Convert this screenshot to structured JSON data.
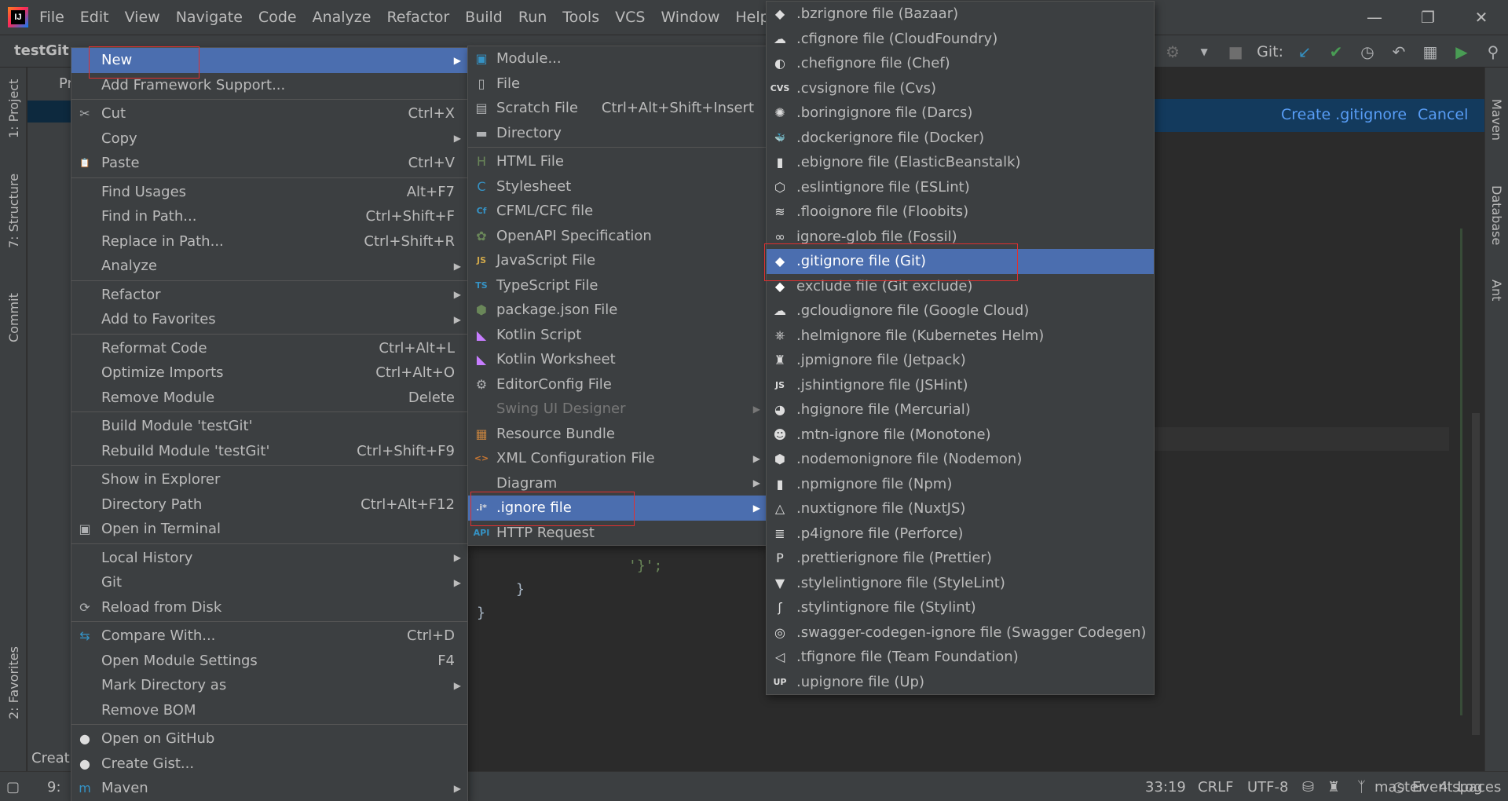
{
  "menubar": {
    "logo": "IJ",
    "items": [
      "File",
      "Edit",
      "View",
      "Navigate",
      "Code",
      "Analyze",
      "Refactor",
      "Build",
      "Run",
      "Tools",
      "VCS",
      "Window",
      "Help"
    ]
  },
  "navbar": {
    "project": "testGit",
    "git_label": "Git:"
  },
  "left_tabs": {
    "project": "1: Project",
    "structure": "7: Structure",
    "commit": "Commit",
    "favorites": "2: Favorites"
  },
  "right_tabs": {
    "maven": "Maven",
    "database": "Database",
    "ant": "Ant"
  },
  "panel": {
    "tab": "Pr"
  },
  "git_banner": {
    "create": "Create .gitignore",
    "cancel": "Cancel"
  },
  "code": {
    "line1": "'}';",
    "line2": "}",
    "line3": "}"
  },
  "context_menu": {
    "items": [
      {
        "label": "New",
        "shortcut": "",
        "submenu": true,
        "icon": ""
      },
      {
        "label": "Add Framework Support...",
        "shortcut": "",
        "submenu": false,
        "icon": ""
      },
      {
        "label": "Cut",
        "shortcut": "Ctrl+X",
        "submenu": false,
        "icon": "scissors-icon"
      },
      {
        "label": "Copy",
        "shortcut": "",
        "submenu": true,
        "icon": ""
      },
      {
        "label": "Paste",
        "shortcut": "Ctrl+V",
        "submenu": false,
        "icon": "clipboard-icon"
      },
      {
        "label": "Find Usages",
        "shortcut": "Alt+F7",
        "submenu": false,
        "icon": ""
      },
      {
        "label": "Find in Path...",
        "shortcut": "Ctrl+Shift+F",
        "submenu": false,
        "icon": ""
      },
      {
        "label": "Replace in Path...",
        "shortcut": "Ctrl+Shift+R",
        "submenu": false,
        "icon": ""
      },
      {
        "label": "Analyze",
        "shortcut": "",
        "submenu": true,
        "icon": ""
      },
      {
        "label": "Refactor",
        "shortcut": "",
        "submenu": true,
        "icon": ""
      },
      {
        "label": "Add to Favorites",
        "shortcut": "",
        "submenu": true,
        "icon": ""
      },
      {
        "label": "Reformat Code",
        "shortcut": "Ctrl+Alt+L",
        "submenu": false,
        "icon": ""
      },
      {
        "label": "Optimize Imports",
        "shortcut": "Ctrl+Alt+O",
        "submenu": false,
        "icon": ""
      },
      {
        "label": "Remove Module",
        "shortcut": "Delete",
        "submenu": false,
        "icon": ""
      },
      {
        "label": "Build Module 'testGit'",
        "shortcut": "",
        "submenu": false,
        "icon": ""
      },
      {
        "label": "Rebuild Module 'testGit'",
        "shortcut": "Ctrl+Shift+F9",
        "submenu": false,
        "icon": ""
      },
      {
        "label": "Show in Explorer",
        "shortcut": "",
        "submenu": false,
        "icon": ""
      },
      {
        "label": "Directory Path",
        "shortcut": "Ctrl+Alt+F12",
        "submenu": false,
        "icon": ""
      },
      {
        "label": "Open in Terminal",
        "shortcut": "",
        "submenu": false,
        "icon": "terminal-icon"
      },
      {
        "label": "Local History",
        "shortcut": "",
        "submenu": true,
        "icon": ""
      },
      {
        "label": "Git",
        "shortcut": "",
        "submenu": true,
        "icon": ""
      },
      {
        "label": "Reload from Disk",
        "shortcut": "",
        "submenu": false,
        "icon": "reload-icon"
      },
      {
        "label": "Compare With...",
        "shortcut": "Ctrl+D",
        "submenu": false,
        "icon": "compare-icon"
      },
      {
        "label": "Open Module Settings",
        "shortcut": "F4",
        "submenu": false,
        "icon": ""
      },
      {
        "label": "Mark Directory as",
        "shortcut": "",
        "submenu": true,
        "icon": ""
      },
      {
        "label": "Remove BOM",
        "shortcut": "",
        "submenu": false,
        "icon": ""
      },
      {
        "label": "Open on GitHub",
        "shortcut": "",
        "submenu": false,
        "icon": "github-icon"
      },
      {
        "label": "Create Gist...",
        "shortcut": "",
        "submenu": false,
        "icon": "github-icon"
      },
      {
        "label": "Maven",
        "shortcut": "",
        "submenu": true,
        "icon": "maven-icon"
      }
    ]
  },
  "new_menu": {
    "items": [
      {
        "label": "Module...",
        "shortcut": "",
        "submenu": false,
        "icon": "module-icon"
      },
      {
        "label": "File",
        "shortcut": "",
        "submenu": false,
        "icon": "file-icon"
      },
      {
        "label": "Scratch File",
        "shortcut": "Ctrl+Alt+Shift+Insert",
        "submenu": false,
        "icon": "scratch-file-icon"
      },
      {
        "label": "Directory",
        "shortcut": "",
        "submenu": false,
        "icon": "folder-icon"
      },
      {
        "label": "HTML File",
        "shortcut": "",
        "submenu": false,
        "icon": "html-file-icon"
      },
      {
        "label": "Stylesheet",
        "shortcut": "",
        "submenu": false,
        "icon": "css-file-icon"
      },
      {
        "label": "CFML/CFC file",
        "shortcut": "",
        "submenu": false,
        "icon": "cfml-file-icon"
      },
      {
        "label": "OpenAPI Specification",
        "shortcut": "",
        "submenu": false,
        "icon": "openapi-icon"
      },
      {
        "label": "JavaScript File",
        "shortcut": "",
        "submenu": false,
        "icon": "js-file-icon"
      },
      {
        "label": "TypeScript File",
        "shortcut": "",
        "submenu": false,
        "icon": "ts-file-icon"
      },
      {
        "label": "package.json File",
        "shortcut": "",
        "submenu": false,
        "icon": "nodejs-icon"
      },
      {
        "label": "Kotlin Script",
        "shortcut": "",
        "submenu": false,
        "icon": "kotlin-icon"
      },
      {
        "label": "Kotlin Worksheet",
        "shortcut": "",
        "submenu": false,
        "icon": "kotlin-icon"
      },
      {
        "label": "EditorConfig File",
        "shortcut": "",
        "submenu": false,
        "icon": "gear-icon"
      },
      {
        "label": "Swing UI Designer",
        "shortcut": "",
        "submenu": true,
        "icon": ""
      },
      {
        "label": "Resource Bundle",
        "shortcut": "",
        "submenu": false,
        "icon": "resource-bundle-icon"
      },
      {
        "label": "XML Configuration File",
        "shortcut": "",
        "submenu": true,
        "icon": "xml-file-icon"
      },
      {
        "label": "Diagram",
        "shortcut": "",
        "submenu": true,
        "icon": ""
      },
      {
        "label": ".ignore file",
        "shortcut": "",
        "submenu": true,
        "icon": "ignore-file-icon"
      },
      {
        "label": "HTTP Request",
        "shortcut": "",
        "submenu": false,
        "icon": "api-icon"
      }
    ]
  },
  "ignore_menu": {
    "items": [
      {
        "label": ".bzrignore file (Bazaar)",
        "icon": "bazaar-icon"
      },
      {
        "label": ".cfignore file (CloudFoundry)",
        "icon": "cloudfoundry-icon"
      },
      {
        "label": ".chefignore file (Chef)",
        "icon": "chef-icon"
      },
      {
        "label": ".cvsignore file (Cvs)",
        "icon": "cvs-icon",
        "glyph": "CVS"
      },
      {
        "label": ".boringignore file (Darcs)",
        "icon": "darcs-icon"
      },
      {
        "label": ".dockerignore file (Docker)",
        "icon": "docker-icon"
      },
      {
        "label": ".ebignore file (ElasticBeanstalk)",
        "icon": "elasticbeanstalk-icon"
      },
      {
        "label": ".eslintignore file (ESLint)",
        "icon": "eslint-icon"
      },
      {
        "label": ".flooignore file (Floobits)",
        "icon": "floobits-icon"
      },
      {
        "label": "ignore-glob file (Fossil)",
        "icon": "fossil-icon"
      },
      {
        "label": ".gitignore file (Git)",
        "icon": "git-icon"
      },
      {
        "label": "exclude file (Git exclude)",
        "icon": "git-icon"
      },
      {
        "label": ".gcloudignore file (Google Cloud)",
        "icon": "gcloud-icon"
      },
      {
        "label": ".helmignore file (Kubernetes Helm)",
        "icon": "helm-icon"
      },
      {
        "label": ".jpmignore file (Jetpack)",
        "icon": "jetpack-icon"
      },
      {
        "label": ".jshintignore file (JSHint)",
        "icon": "jshint-icon",
        "glyph": "JS"
      },
      {
        "label": ".hgignore file (Mercurial)",
        "icon": "mercurial-icon"
      },
      {
        "label": ".mtn-ignore file (Monotone)",
        "icon": "monotone-icon"
      },
      {
        "label": ".nodemonignore file (Nodemon)",
        "icon": "nodemon-icon"
      },
      {
        "label": ".npmignore file (Npm)",
        "icon": "npm-icon"
      },
      {
        "label": ".nuxtignore file (NuxtJS)",
        "icon": "nuxtjs-icon"
      },
      {
        "label": ".p4ignore file (Perforce)",
        "icon": "perforce-icon"
      },
      {
        "label": ".prettierignore file (Prettier)",
        "icon": "prettier-icon"
      },
      {
        "label": ".stylelintignore file (StyleLint)",
        "icon": "stylelint-icon"
      },
      {
        "label": ".stylintignore file (Stylint)",
        "icon": "stylint-icon"
      },
      {
        "label": ".swagger-codegen-ignore file (Swagger Codegen)",
        "icon": "swagger-icon"
      },
      {
        "label": ".tfignore file (Team Foundation)",
        "icon": "tfs-icon"
      },
      {
        "label": ".upignore file (Up)",
        "icon": "up-icon",
        "glyph": "UP"
      }
    ]
  },
  "status": {
    "event_log": "Event Log",
    "position": "33:19",
    "line_sep": "CRLF",
    "encoding": "UTF-8",
    "branch": "master",
    "indent": "4 spaces",
    "bottom_left_tab": "9:",
    "bottom_left_label": "Creat"
  },
  "colors": {
    "selection": "#4b6eaf",
    "menu_bg": "#3c3f41",
    "editor_bg": "#2b2b2b",
    "banner_bg": "#133a5d",
    "link": "#589df6",
    "highlight_box": "#e03030"
  }
}
